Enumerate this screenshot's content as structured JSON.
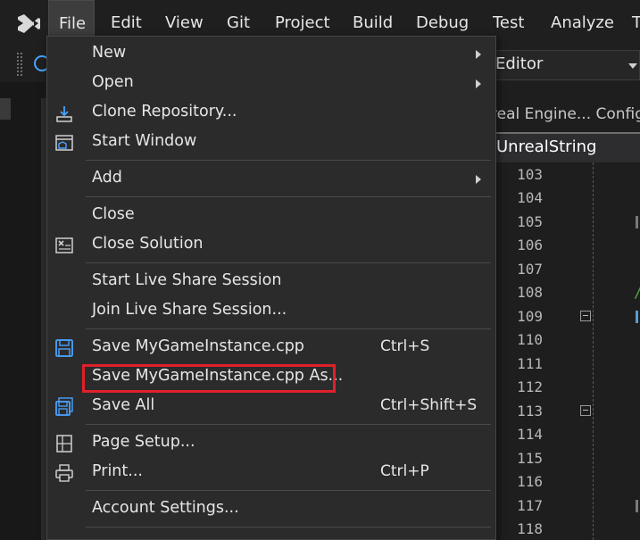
{
  "menubar": {
    "items": [
      {
        "label": "File"
      },
      {
        "label": "Edit"
      },
      {
        "label": "View"
      },
      {
        "label": "Git"
      },
      {
        "label": "Project"
      },
      {
        "label": "Build"
      },
      {
        "label": "Debug"
      },
      {
        "label": "Test"
      },
      {
        "label": "Analyze"
      },
      {
        "label": "T"
      }
    ]
  },
  "toolbar": {
    "config_dropdown": "Editor"
  },
  "editor": {
    "breadcrumb": "real Engine... Config",
    "tab": "UnrealString",
    "line_numbers": [
      "103",
      "104",
      "105",
      "106",
      "107",
      "108",
      "109",
      "110",
      "111",
      "112",
      "113",
      "114",
      "115",
      "116",
      "117",
      "118"
    ],
    "code_fragment": "//"
  },
  "file_menu": {
    "items": {
      "new": {
        "label": "New",
        "icon": "none"
      },
      "open": {
        "label": "Open",
        "icon": "none"
      },
      "clone": {
        "label": "Clone Repository...",
        "icon": "download-icon"
      },
      "start_window": {
        "label": "Start Window",
        "icon": "start-window-icon"
      },
      "add": {
        "label": "Add"
      },
      "close": {
        "label": "Close"
      },
      "close_solution": {
        "label": "Close Solution",
        "icon": "close-solution-icon"
      },
      "start_live_share": {
        "label": "Start Live Share Session"
      },
      "join_live_share": {
        "label": "Join Live Share Session..."
      },
      "save": {
        "label": "Save MyGameInstance.cpp",
        "shortcut": "Ctrl+S",
        "icon": "save-icon"
      },
      "save_as": {
        "label": "Save MyGameInstance.cpp As..."
      },
      "save_all": {
        "label": "Save All",
        "shortcut": "Ctrl+Shift+S",
        "icon": "save-all-icon"
      },
      "page_setup": {
        "label": "Page Setup...",
        "icon": "page-setup-icon"
      },
      "print": {
        "label": "Print...",
        "shortcut": "Ctrl+P",
        "icon": "printer-icon"
      },
      "account_settings": {
        "label": "Account Settings..."
      }
    }
  },
  "colors": {
    "accent_blue": "#4aa3ff",
    "highlight_red": "#e0202a",
    "menu_bg": "#2b2b2b"
  }
}
